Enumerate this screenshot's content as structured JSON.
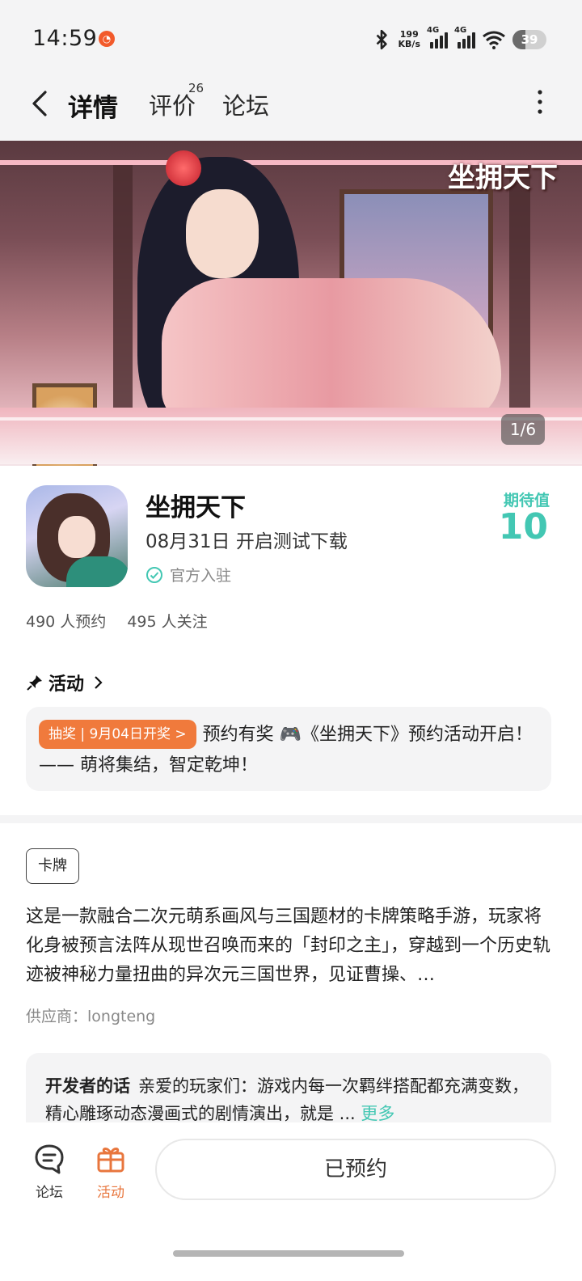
{
  "status_bar": {
    "time": "14:59",
    "net_speed_value": "199",
    "net_speed_unit": "KB/s",
    "sim1_label": "4G",
    "sim2_label": "4G",
    "battery": "39"
  },
  "nav": {
    "tabs": [
      {
        "label": "详情",
        "active": true
      },
      {
        "label": "评价",
        "count": "26"
      },
      {
        "label": "论坛"
      }
    ]
  },
  "banner": {
    "logo_text": "坐拥天下",
    "counter": "1/6"
  },
  "game": {
    "title": "坐拥天下",
    "release": "08月31日 开启测试下载",
    "official_label": "官方入驻",
    "expect_label": "期待值",
    "expect_value": "10",
    "reservations": "490 人预约",
    "followers": "495 人关注"
  },
  "activity": {
    "header": "活动",
    "badge": "抽奖 | 9月04日开奖 >",
    "text": "预约有奖 🎮《坐拥天下》预约活动开启！—— 萌将集结，智定乾坤！"
  },
  "description": {
    "tag": "卡牌",
    "text": "这是一款融合二次元萌系画风与三国题材的卡牌策略手游，玩家将化身被预言法阵从现世召唤而来的「封印之主」，穿越到一个历史轨迹被神秘力量扭曲的异次元三国世界，见证曹操、…",
    "supplier": "供应商：longteng"
  },
  "developer_note": {
    "label": "开发者的话",
    "text": "亲爱的玩家们：游戏内每一次羁绊搭配都充满变数，精心雕琢动态漫画式的剧情演出，就是 ...",
    "more": "更多"
  },
  "bottom_bar": {
    "forum_label": "论坛",
    "activity_label": "活动",
    "reserved_label": "已预约"
  },
  "colors": {
    "accent_teal": "#43c7b3",
    "accent_orange": "#f07a3c",
    "page_bg": "#f4f4f5"
  }
}
